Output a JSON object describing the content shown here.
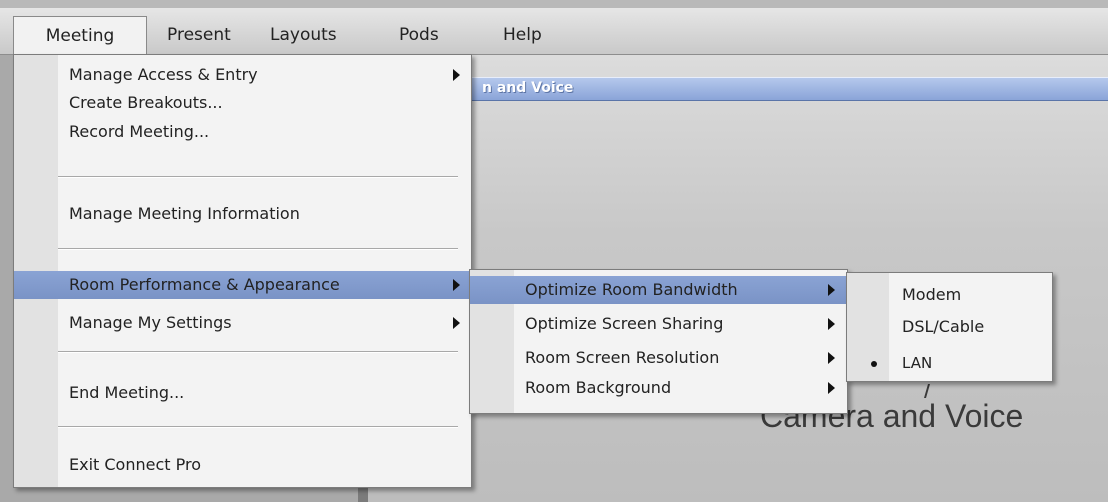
{
  "menubar": {
    "items": [
      "Meeting",
      "Present",
      "Layouts",
      "Pods",
      "Help"
    ]
  },
  "pod": {
    "title_partial": "n and Voice",
    "big_text": "Camera and Voice"
  },
  "meeting_menu": {
    "items": [
      {
        "label": "Manage Access & Entry",
        "has_submenu": true
      },
      {
        "label": "Create Breakouts...",
        "has_submenu": false
      },
      {
        "label": "Record Meeting...",
        "has_submenu": false
      },
      {
        "label": "Manage Meeting Information",
        "has_submenu": false
      },
      {
        "label": "Room Performance & Appearance",
        "has_submenu": true,
        "highlighted": true
      },
      {
        "label": "Manage My Settings",
        "has_submenu": true
      },
      {
        "label": "End Meeting...",
        "has_submenu": false
      },
      {
        "label": "Exit Connect Pro",
        "has_submenu": false
      }
    ]
  },
  "room_performance_menu": {
    "items": [
      {
        "label": "Optimize Room Bandwidth",
        "has_submenu": true,
        "highlighted": true
      },
      {
        "label": "Optimize Screen Sharing",
        "has_submenu": true
      },
      {
        "label": "Room Screen Resolution",
        "has_submenu": true
      },
      {
        "label": "Room Background",
        "has_submenu": true
      }
    ]
  },
  "bandwidth_menu": {
    "items": [
      {
        "label": "Modem",
        "selected": false
      },
      {
        "label": "DSL/Cable",
        "selected": false
      },
      {
        "label": "LAN",
        "selected": true
      }
    ]
  },
  "colors": {
    "highlight": "#7f98ca",
    "menu_bg": "#f3f3f3",
    "pod_title_bar": "#8aa4d8"
  }
}
